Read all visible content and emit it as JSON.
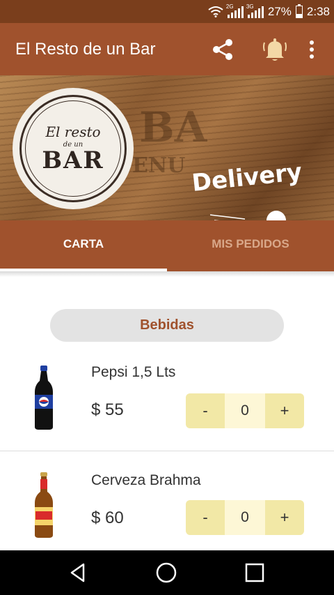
{
  "status_bar": {
    "net1": "2G",
    "net2": "3G",
    "battery": "27%",
    "time": "2:38",
    "battery_level": 0.27
  },
  "app_bar": {
    "title": "El Resto de un Bar",
    "actions": [
      "share-icon",
      "bell-icon",
      "more-vert-icon"
    ]
  },
  "banner": {
    "logo_line1": "El resto",
    "logo_line2": "de un",
    "logo_line3": "BAR",
    "delivery_text": "Delivery"
  },
  "tabs": [
    {
      "label": "CARTA",
      "active": true
    },
    {
      "label": "MIS PEDIDOS",
      "active": false
    }
  ],
  "menu": {
    "category": "Bebidas",
    "products": [
      {
        "name": "Pepsi 1,5 Lts",
        "price": "$ 55",
        "minus": "-",
        "quantity": "0",
        "plus": "+"
      },
      {
        "name": "Cerveza Brahma",
        "price": "$ 60",
        "minus": "-",
        "quantity": "0",
        "plus": "+"
      }
    ]
  },
  "colors": {
    "status_bar": "#7a3e1c",
    "primary": "#a0522d",
    "stepper_button": "#f2e8a6",
    "stepper_value": "#fdf7d6"
  },
  "nav_bar": [
    "back-icon",
    "home-icon",
    "recents-icon"
  ]
}
